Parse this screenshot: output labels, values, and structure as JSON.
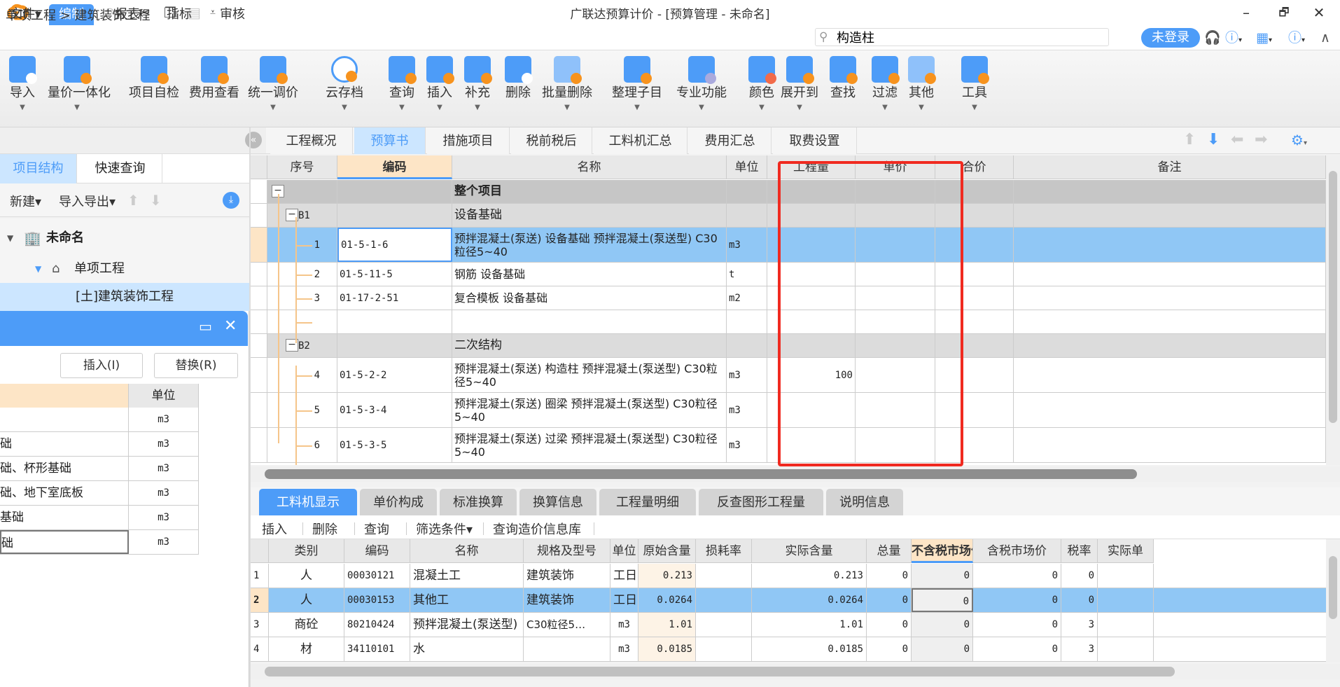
{
  "app": {
    "title": "广联达预算计价 - [预算管理 - 未命名]",
    "window_controls": {
      "minimize": "–",
      "restore": "🗗",
      "close": "✕"
    }
  },
  "quick_access": [
    {
      "name": "save-icon",
      "glyph": "🖫"
    },
    {
      "name": "undo-icon",
      "glyph": "↶"
    },
    {
      "name": "redo-icon",
      "glyph": "↷"
    },
    {
      "name": "cut-icon",
      "glyph": "✂"
    },
    {
      "name": "copy-icon",
      "glyph": "❐"
    },
    {
      "name": "paste-icon",
      "glyph": "📋"
    },
    {
      "name": "customize-icon",
      "glyph": "⩡"
    }
  ],
  "menu": {
    "items": [
      "文件▾",
      "编制",
      "报表",
      "指标",
      "审核"
    ],
    "active": "编制"
  },
  "search": {
    "value": "构造柱",
    "placeholder": ""
  },
  "account": {
    "login_label": "未登录"
  },
  "ribbon": [
    {
      "label": "导入",
      "dropdown": true,
      "icon": "import-icon"
    },
    {
      "label": "量价一体化",
      "dropdown": true,
      "icon": "price-integration-icon"
    },
    {
      "label": "项目自检",
      "dropdown": false,
      "icon": "self-check-icon"
    },
    {
      "label": "费用查看",
      "dropdown": false,
      "icon": "cost-view-icon"
    },
    {
      "label": "统一调价",
      "dropdown": true,
      "icon": "adjust-price-icon"
    },
    {
      "label": "云存档",
      "dropdown": true,
      "icon": "cloud-upload-icon"
    },
    {
      "label": "查询",
      "dropdown": true,
      "icon": "query-icon"
    },
    {
      "label": "插入",
      "dropdown": true,
      "icon": "insert-icon"
    },
    {
      "label": "补充",
      "dropdown": true,
      "icon": "supplement-icon"
    },
    {
      "label": "删除",
      "dropdown": false,
      "icon": "delete-icon"
    },
    {
      "label": "批量删除",
      "dropdown": true,
      "icon": "batch-delete-icon"
    },
    {
      "label": "整理子目",
      "dropdown": true,
      "icon": "organize-icon"
    },
    {
      "label": "专业功能",
      "dropdown": true,
      "icon": "professional-icon"
    },
    {
      "label": "颜色",
      "dropdown": true,
      "icon": "color-icon"
    },
    {
      "label": "展开到",
      "dropdown": true,
      "icon": "expand-to-icon"
    },
    {
      "label": "查找",
      "dropdown": false,
      "icon": "find-icon"
    },
    {
      "label": "过滤",
      "dropdown": true,
      "icon": "filter-icon"
    },
    {
      "label": "其他",
      "dropdown": true,
      "icon": "other-icon"
    },
    {
      "label": "工具",
      "dropdown": true,
      "icon": "tools-icon"
    }
  ],
  "breadcrumb": "单项工程 > 建筑装饰工程",
  "left_panel": {
    "tabs": [
      "项目结构",
      "快速查询"
    ],
    "active_tab": "项目结构",
    "tools": {
      "new": "新建▾",
      "import_export": "导入导出▾"
    },
    "tree": [
      {
        "label": "未命名",
        "level": 0
      },
      {
        "label": "单项工程",
        "level": 1
      },
      {
        "label": "[土]建筑装饰工程",
        "level": 2,
        "selected": true
      }
    ]
  },
  "popup": {
    "insert_label": "插入(I)",
    "replace_label": "替换(R)",
    "unit_header": "单位",
    "rows": [
      {
        "name": "",
        "unit": "m3"
      },
      {
        "name": "础",
        "unit": "m3"
      },
      {
        "name": "础、杯形基础",
        "unit": "m3"
      },
      {
        "name": "础、地下室底板",
        "unit": "m3"
      },
      {
        "name": "基础",
        "unit": "m3"
      },
      {
        "name": "础",
        "unit": "m3"
      }
    ]
  },
  "main_tabs": {
    "items": [
      "工程概况",
      "预算书",
      "措施项目",
      "税前税后",
      "工料机汇总",
      "费用汇总",
      "取费设置"
    ],
    "active": "预算书"
  },
  "budget_grid": {
    "headers": [
      "序号",
      "编码",
      "名称",
      "单位",
      "工程量",
      "单价",
      "合价",
      "备注"
    ],
    "highlight_header": "编码",
    "rows": [
      {
        "type": "top",
        "seq": "",
        "code": "",
        "name": "整个项目",
        "unit": "",
        "qty": "",
        "price": "",
        "total": "",
        "note": ""
      },
      {
        "type": "group",
        "seq": "B1",
        "code": "",
        "name": "设备基础",
        "unit": "",
        "qty": "",
        "price": "",
        "total": "",
        "note": ""
      },
      {
        "type": "item",
        "selected": true,
        "seq": "1",
        "code": "01-5-1-6",
        "name": "预拌混凝土(泵送) 设备基础 预拌混凝土(泵送型) C30粒径5~40",
        "unit": "m3",
        "qty": "",
        "price": "",
        "total": "",
        "note": ""
      },
      {
        "type": "item",
        "seq": "2",
        "code": "01-5-11-5",
        "name": "钢筋 设备基础",
        "unit": "t",
        "qty": "",
        "price": "",
        "total": "",
        "note": ""
      },
      {
        "type": "item",
        "seq": "3",
        "code": "01-17-2-51",
        "name": "复合模板 设备基础",
        "unit": "m2",
        "qty": "",
        "price": "",
        "total": "",
        "note": ""
      },
      {
        "type": "item",
        "seq": "",
        "code": "",
        "name": "",
        "unit": "",
        "qty": "",
        "price": "",
        "total": "",
        "note": ""
      },
      {
        "type": "group",
        "seq": "B2",
        "code": "",
        "name": "二次结构",
        "unit": "",
        "qty": "",
        "price": "",
        "total": "",
        "note": ""
      },
      {
        "type": "item",
        "seq": "4",
        "code": "01-5-2-2",
        "name": "预拌混凝土(泵送) 构造柱 预拌混凝土(泵送型) C30粒径5~40",
        "unit": "m3",
        "qty": "100",
        "price": "",
        "total": "",
        "note": ""
      },
      {
        "type": "item",
        "seq": "5",
        "code": "01-5-3-4",
        "name": "预拌混凝土(泵送) 圈梁 预拌混凝土(泵送型) C30粒径5~40",
        "unit": "m3",
        "qty": "",
        "price": "",
        "total": "",
        "note": ""
      },
      {
        "type": "item",
        "seq": "6",
        "code": "01-5-3-5",
        "name": "预拌混凝土(泵送) 过梁 预拌混凝土(泵送型) C30粒径5~40",
        "unit": "m3",
        "qty": "",
        "price": "",
        "total": "",
        "note": ""
      }
    ]
  },
  "bottom_tabs": {
    "items": [
      "工料机显示",
      "单价构成",
      "标准换算",
      "换算信息",
      "工程量明细",
      "反查图形工程量",
      "说明信息"
    ],
    "active": "工料机显示"
  },
  "bottom_tools": [
    "插入",
    "删除",
    "查询",
    "筛选条件▾",
    "查询造价信息库"
  ],
  "resource_grid": {
    "headers": [
      "",
      "类别",
      "编码",
      "名称",
      "规格及型号",
      "单位",
      "原始含量",
      "损耗率",
      "实际含量",
      "总量",
      "不含税市场价",
      "含税市场价",
      "税率",
      "实际单"
    ],
    "highlight_header": "不含税市场价",
    "rows": [
      {
        "no": "1",
        "category": "人",
        "code": "00030121",
        "name": "混凝土工",
        "spec": "建筑装饰",
        "unit": "工日",
        "orig_qty": "0.213",
        "loss": "",
        "actual_qty": "0.213",
        "total": "0",
        "price_ex_tax": "0",
        "price_inc_tax": "0",
        "tax_rate": "0",
        "actual_price": ""
      },
      {
        "no": "2",
        "selected": true,
        "category": "人",
        "code": "00030153",
        "name": "其他工",
        "spec": "建筑装饰",
        "unit": "工日",
        "orig_qty": "0.0264",
        "loss": "",
        "actual_qty": "0.0264",
        "total": "0",
        "price_ex_tax": "0",
        "price_inc_tax": "0",
        "tax_rate": "0",
        "actual_price": ""
      },
      {
        "no": "3",
        "category": "商砼",
        "code": "80210424",
        "name": "预拌混凝土(泵送型)",
        "spec": "C30粒径5…",
        "unit": "m3",
        "orig_qty": "1.01",
        "loss": "",
        "actual_qty": "1.01",
        "total": "0",
        "price_ex_tax": "0",
        "price_inc_tax": "0",
        "tax_rate": "3",
        "actual_price": ""
      },
      {
        "no": "4",
        "category": "材",
        "code": "34110101",
        "name": "水",
        "spec": "",
        "unit": "m3",
        "orig_qty": "0.0185",
        "loss": "",
        "actual_qty": "0.0185",
        "total": "0",
        "price_ex_tax": "0",
        "price_inc_tax": "0",
        "tax_rate": "3",
        "actual_price": ""
      }
    ]
  },
  "colors": {
    "accent": "#4d9cf8",
    "selected_row": "#90c7f5",
    "highlight_header": "#fde5c6",
    "annotation_red": "#f02a20",
    "brand_orange": "#f7931e"
  }
}
